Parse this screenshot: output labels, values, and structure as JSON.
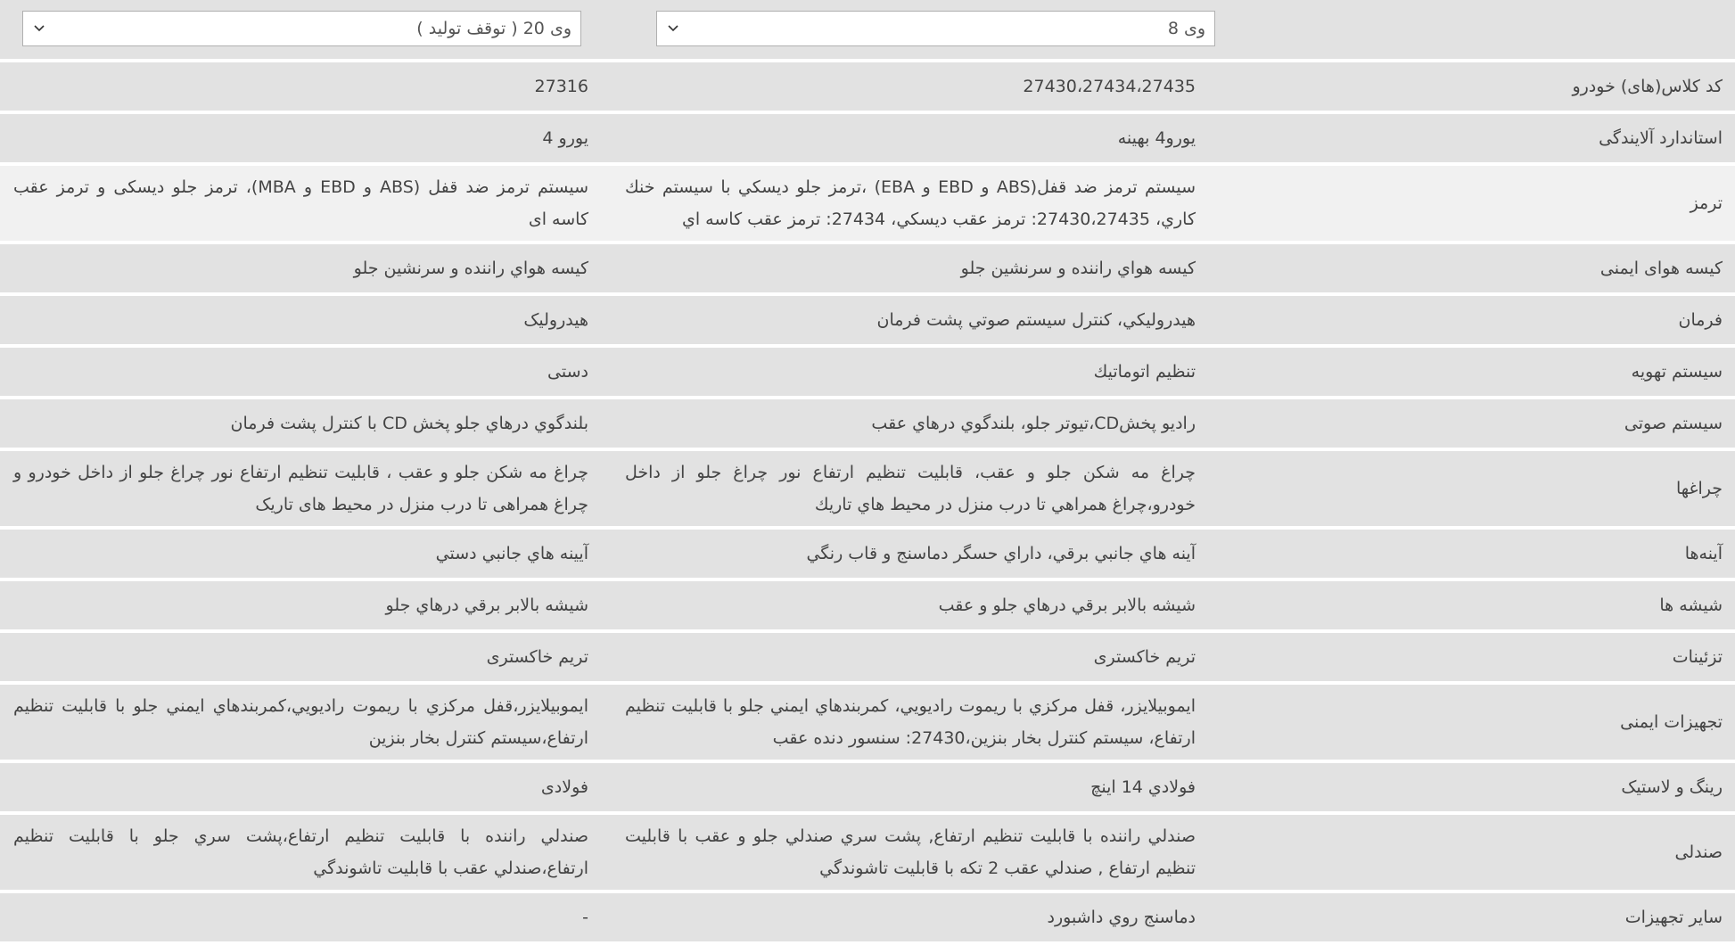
{
  "selectors": {
    "col_a": "وی 8",
    "col_b": "وی 20 ( توقف تولید )"
  },
  "rows": [
    {
      "label": "کد کلاس(های) خودرو",
      "a": "27430،27434،27435",
      "b": "27316"
    },
    {
      "label": "استاندارد آلایندگی",
      "a": "يورو4 بهينه",
      "b": "یورو 4"
    },
    {
      "label": "ترمز",
      "a": "سيستم ترمز ضد قفل(ABS و EBD و EBA) ،ترمز جلو ديسكي با سيستم خنك كاري، 27430،27435: ترمز عقب ديسكي، 27434: ترمز عقب كاسه اي",
      "b": "سیستم ترمز ضد قفل (ABS و EBD و MBA)، ترمز جلو دیسکی و ترمز عقب کاسه ای"
    },
    {
      "label": "کیسه هوای ایمنی",
      "a": "كيسه هواي راننده و سرنشين جلو",
      "b": "كيسه هواي راننده و سرنشين جلو"
    },
    {
      "label": "فرمان",
      "a": "هيدروليكي، كنترل سيستم صوتي پشت فرمان",
      "b": "هیدرولیک"
    },
    {
      "label": "سیستم تهویه",
      "a": "تنظيم اتوماتيك",
      "b": "دستی"
    },
    {
      "label": "سیستم صوتی",
      "a": "راديو پخشCD،تيوتر جلو، بلندگوي درهاي عقب",
      "b": "بلندگوي درهاي جلو پخش CD با كنترل پشت فرمان"
    },
    {
      "label": "چراغها",
      "a": "چراغ مه شكن جلو و عقب، قابليت تنظيم ارتفاع نور چراغ جلو از داخل خودرو،چراغ همراهي تا درب منزل در محيط هاي تاريك",
      "b": "چراغ مه شکن جلو و عقب ، قابلیت تنظیم ارتفاع نور چراغ جلو از داخل خودرو و چراغ همراهی تا درب منزل در محیط های تاریک"
    },
    {
      "label": "آینه‌ها",
      "a": "آينه هاي جانبي برقي، داراي حسگر دماسنج و قاب رنگي",
      "b": "آيينه هاي جانبي دستي"
    },
    {
      "label": "شیشه ها",
      "a": "شيشه بالابر برقي درهاي جلو و عقب",
      "b": "شيشه بالابر برقي درهاي جلو"
    },
    {
      "label": "تزئینات",
      "a": "تریم خاکستری",
      "b": "تریم خاکستری"
    },
    {
      "label": "تجهیزات ایمنی",
      "a": "ايموبيلايزر، قفل مركزي با ريموت راديويي، كمربندهاي ايمني جلو با قابليت تنظيم ارتفاع، سيستم كنترل بخار بنزين،27430: سنسور دنده عقب",
      "b": "ايموبيلايزر،قفل مركزي با ريموت راديويي،كمربندهاي ايمني جلو با قابليت تنظيم ارتفاع،سيستم كنترل بخار بنزين"
    },
    {
      "label": "رینگ و لاستیک",
      "a": "فولادي 14 اينچ",
      "b": "فولادی"
    },
    {
      "label": "صندلی",
      "a": "صندلي راننده با قابليت تنظيم ارتفاع, پشت سري صندلي جلو و عقب با قابليت تنظيم ارتفاع , صندلي عقب 2 تكه با قابليت تاشوندگي",
      "b": "صندلي راننده با قابليت تنظيم ارتفاع،پشت سري جلو با قابليت تنظيم ارتفاع،صندلي عقب با قابليت تاشوندگي"
    },
    {
      "label": "سایر تجهیزات",
      "a": "دماسنج روي داشبورد",
      "b": "-"
    }
  ]
}
